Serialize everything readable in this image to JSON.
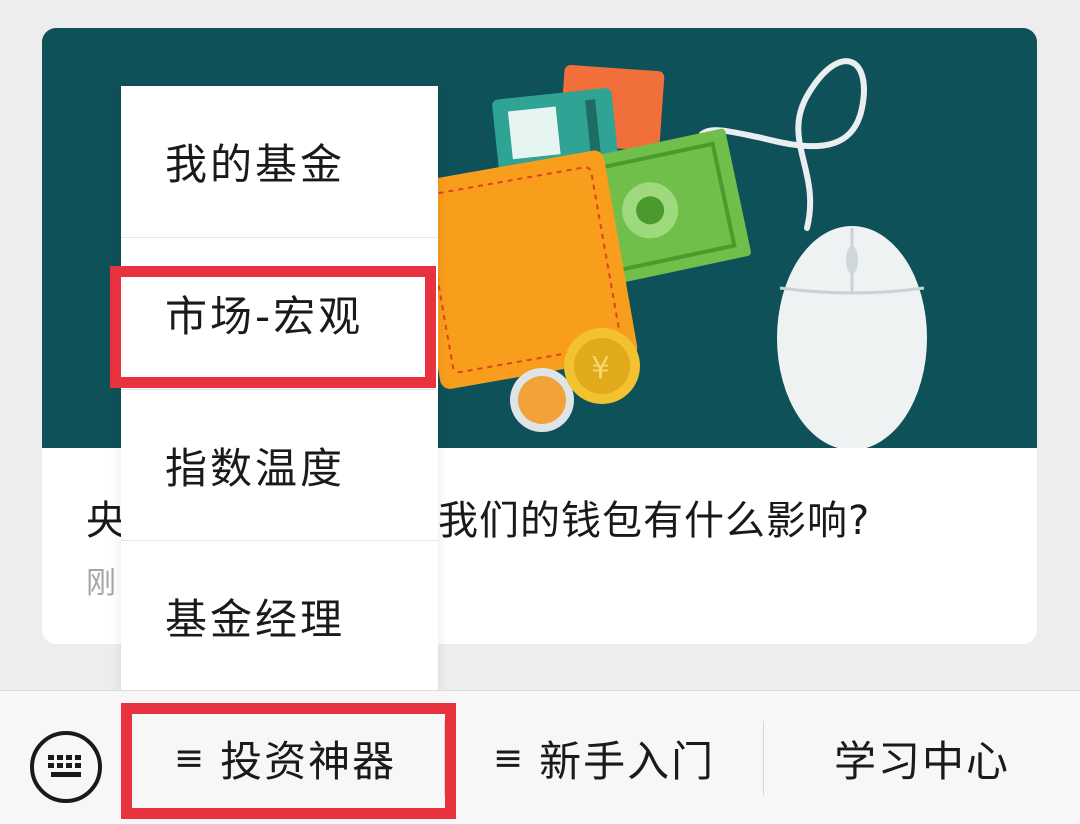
{
  "article": {
    "title": "央行降准对我们的钱包有什么影响?",
    "title_visible_start": "央",
    "title_visible_end": "我们的钱包有什么影响?",
    "time_visible": "刚"
  },
  "menu": {
    "items": [
      {
        "label": "我的基金"
      },
      {
        "label": "市场-宏观"
      },
      {
        "label": "指数温度"
      },
      {
        "label": "基金经理"
      }
    ]
  },
  "bottom_bar": {
    "keyboard_icon": "keyboard-icon",
    "tabs": [
      {
        "icon": "≡",
        "label": "投资神器"
      },
      {
        "icon": "≡",
        "label": "新手入门"
      },
      {
        "label": "学习中心"
      }
    ]
  },
  "colors": {
    "highlight": "#e8323f",
    "cover_background": "#0f5158"
  }
}
